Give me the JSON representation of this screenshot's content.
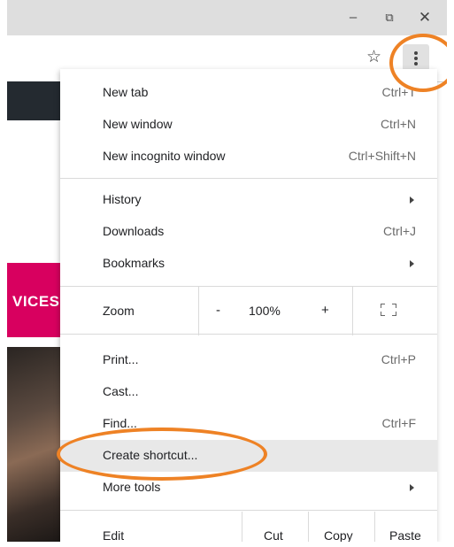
{
  "window": {
    "minimize_icon": "minimize-icon",
    "restore_icon": "restore-icon",
    "close_icon": "close-icon",
    "minimize_glyph": "–",
    "restore_glyph": "⧉",
    "close_glyph": "✕"
  },
  "toolbar": {
    "star_glyph": "☆",
    "menu_icon": "kebab-menu-icon"
  },
  "background_page": {
    "banner_text": "VICES"
  },
  "menu": {
    "items_top": [
      {
        "label": "New tab",
        "shortcut": "Ctrl+T"
      },
      {
        "label": "New window",
        "shortcut": "Ctrl+N"
      },
      {
        "label": "New incognito window",
        "shortcut": "Ctrl+Shift+N"
      }
    ],
    "items_mid": [
      {
        "label": "History",
        "has_submenu": true
      },
      {
        "label": "Downloads",
        "shortcut": "Ctrl+J"
      },
      {
        "label": "Bookmarks",
        "has_submenu": true
      }
    ],
    "zoom": {
      "label": "Zoom",
      "minus": "-",
      "value": "100%",
      "plus": "+",
      "fullscreen_icon": "fullscreen-icon"
    },
    "items_bottom": [
      {
        "label": "Print...",
        "shortcut": "Ctrl+P"
      },
      {
        "label": "Cast..."
      },
      {
        "label": "Find...",
        "shortcut": "Ctrl+F"
      },
      {
        "label": "Create shortcut...",
        "highlighted": true
      },
      {
        "label": "More tools",
        "has_submenu": true
      }
    ],
    "edit": {
      "label": "Edit",
      "cut": "Cut",
      "copy": "Copy",
      "paste": "Paste"
    }
  },
  "colors": {
    "annotation_orange": "#ee8225",
    "titlebar_gray": "#dedede",
    "highlight_row": "#e8e8e8",
    "banner_pink": "#d8005f"
  }
}
